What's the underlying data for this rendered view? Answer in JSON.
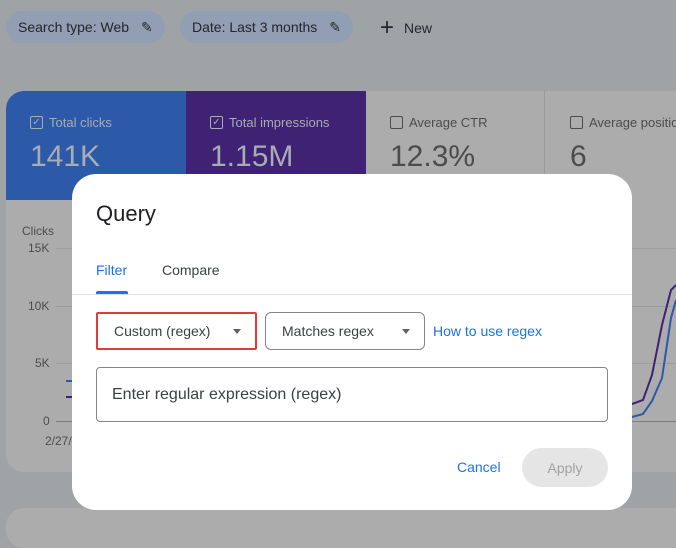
{
  "filters": {
    "search_type": "Search type: Web",
    "date": "Date: Last 3 months",
    "new_label": "New"
  },
  "metrics": [
    {
      "label": "Total clicks",
      "value": "141K",
      "checked": true,
      "color": "#2c5aa8"
    },
    {
      "label": "Total impressions",
      "value": "1.15M",
      "checked": true,
      "color": "#3f2273"
    },
    {
      "label": "Average CTR",
      "value": "12.3%",
      "checked": false
    },
    {
      "label": "Average position",
      "value": "6",
      "checked": false
    }
  ],
  "chart": {
    "ylabel": "Clicks",
    "yticks": [
      "15K",
      "10K",
      "5K",
      "0"
    ],
    "first_date": "2/27/"
  },
  "dialog": {
    "title": "Query",
    "tabs": [
      {
        "label": "Filter",
        "active": true
      },
      {
        "label": "Compare",
        "active": false
      }
    ],
    "dimension_select": "Custom (regex)",
    "match_select": "Matches regex",
    "help_link": "How to use regex",
    "regex_placeholder": "Enter regular expression (regex)",
    "cancel_label": "Cancel",
    "apply_label": "Apply"
  }
}
